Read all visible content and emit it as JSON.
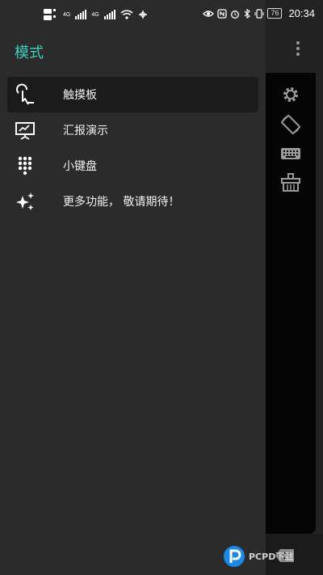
{
  "status_bar": {
    "left_labels": [
      "4G",
      "4G"
    ],
    "battery": "76",
    "time": "20:34"
  },
  "drawer": {
    "title": "模式",
    "items": [
      {
        "label": "触摸板",
        "icon": "touchpad-icon",
        "active": true
      },
      {
        "label": "汇报演示",
        "icon": "presentation-icon",
        "active": false
      },
      {
        "label": "小键盘",
        "icon": "keypad-icon",
        "active": false
      },
      {
        "label": "更多功能， 敬请期待！",
        "icon": "sparkle-icon",
        "active": false
      }
    ]
  },
  "background_app": {
    "icons": [
      "settings-icon",
      "screen-rotate-icon",
      "keyboard-icon",
      "clear-icon",
      "more-vert-icon",
      "backspace-icon"
    ]
  },
  "watermark": {
    "text": "PCPD下载"
  },
  "colors": {
    "accent": "#3fd0c0",
    "drawer_bg": "#2b2b2b",
    "active_item_bg": "#1b1b1b"
  }
}
